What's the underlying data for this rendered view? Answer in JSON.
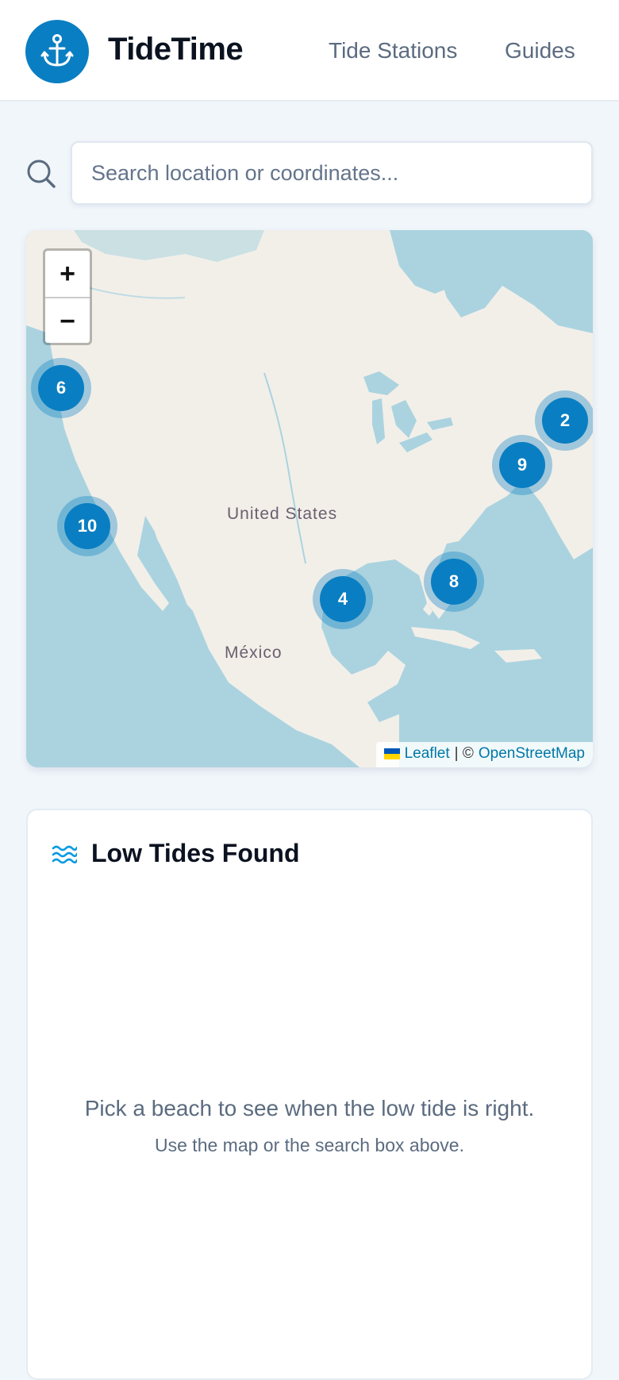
{
  "header": {
    "brand": "TideTime",
    "logo_icon": "anchor-icon",
    "nav": [
      {
        "label": "Tide Stations"
      },
      {
        "label": "Guides"
      }
    ],
    "accent_color": "#0a7ec2"
  },
  "search": {
    "icon": "search-icon",
    "placeholder": "Search location or coordinates...",
    "value": ""
  },
  "map": {
    "labels": {
      "country_1": "United States",
      "country_2": "México"
    },
    "zoom_in": "+",
    "zoom_out": "−",
    "clusters": [
      {
        "count": "6"
      },
      {
        "count": "2"
      },
      {
        "count": "9"
      },
      {
        "count": "10"
      },
      {
        "count": "8"
      },
      {
        "count": "4"
      }
    ],
    "attribution": {
      "leaflet": "Leaflet",
      "separator": "| ©",
      "osm": "OpenStreetMap"
    }
  },
  "results": {
    "icon": "waves-icon",
    "title": "Low Tides Found",
    "empty_message": "Pick a beach to see when the low tide is right.",
    "empty_hint": "Use the map or the search box above."
  }
}
